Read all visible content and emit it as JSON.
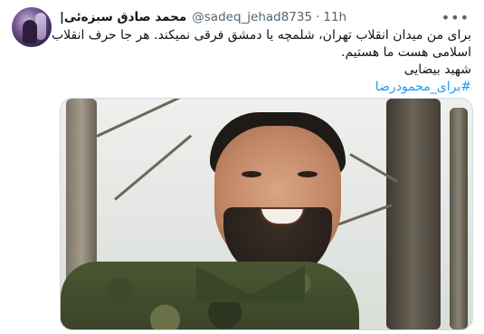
{
  "tweet": {
    "display_name": "محمد صادق سبزه‌ئی|",
    "handle": "@sadeq_jehad8735",
    "separator": "·",
    "time": "11h",
    "more_icon": "more-horizontal-icon",
    "lines": [
      "برای من میدان انقلاب تهران، شلمچه یا دمشق فرقی نمیکند. هر جا حرف انقلاب",
      "اسلامی هست ما هستیم.",
      "شهید بیضایی"
    ],
    "hashtag": "#برای_محمودرضا"
  },
  "colors": {
    "text": "#0f1419",
    "secondary": "#536471",
    "link": "#1d9bf0"
  }
}
